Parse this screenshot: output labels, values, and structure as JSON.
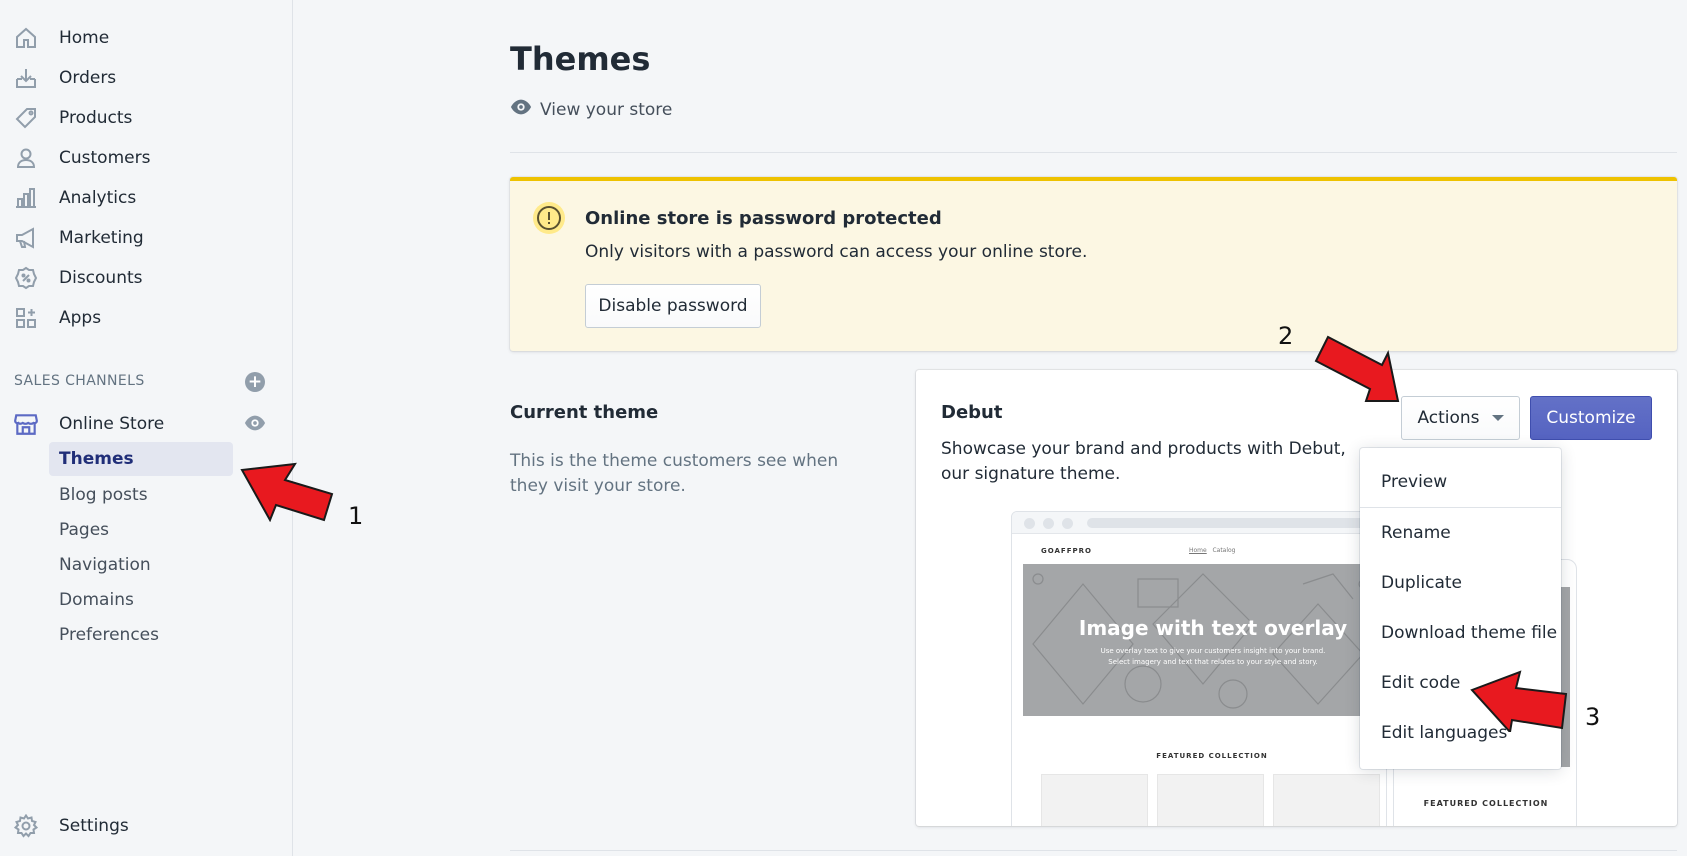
{
  "sidebar": {
    "nav": [
      {
        "label": "Home",
        "icon": "home-icon"
      },
      {
        "label": "Orders",
        "icon": "orders-icon"
      },
      {
        "label": "Products",
        "icon": "tag-icon"
      },
      {
        "label": "Customers",
        "icon": "person-icon"
      },
      {
        "label": "Analytics",
        "icon": "bar-chart-icon"
      },
      {
        "label": "Marketing",
        "icon": "megaphone-icon"
      },
      {
        "label": "Discounts",
        "icon": "discount-icon"
      },
      {
        "label": "Apps",
        "icon": "apps-icon"
      }
    ],
    "sales_channels_heading": "SALES CHANNELS",
    "online_store": "Online Store",
    "sub_items": [
      "Themes",
      "Blog posts",
      "Pages",
      "Navigation",
      "Domains",
      "Preferences"
    ],
    "active_sub_item": "Themes",
    "settings": "Settings"
  },
  "main": {
    "title": "Themes",
    "view_store": "View your store",
    "banner": {
      "title": "Online store is password protected",
      "text": "Only visitors with a password can access your online store.",
      "button": "Disable password"
    },
    "current_theme": {
      "heading": "Current theme",
      "description": "This is the theme customers see when they visit your store."
    },
    "theme_card": {
      "name": "Debut",
      "description": "Showcase your brand and products with Debut, our signature theme.",
      "actions_button": "Actions",
      "customize_button": "Customize",
      "preview": {
        "brand": "GOAFFPRO",
        "nav_home": "Home",
        "nav_catalog": "Catalog",
        "hero_title": "Image with text overlay",
        "hero_line1": "Use overlay text to give your customers insight into your brand.",
        "hero_line2": "Select imagery and text that relates to your style and story.",
        "featured": "FEATURED COLLECTION"
      }
    },
    "actions_menu": [
      "Preview",
      "Rename",
      "Duplicate",
      "Download theme file",
      "Edit code",
      "Edit languages"
    ]
  },
  "annotations": {
    "step1": "1",
    "step2": "2",
    "step3": "3"
  },
  "colors": {
    "accent": "#5c6ac4",
    "active_text": "#202e78",
    "banner_bg": "#fcf7e3",
    "banner_border": "#eec200",
    "arrow_fill": "#e8191f"
  }
}
